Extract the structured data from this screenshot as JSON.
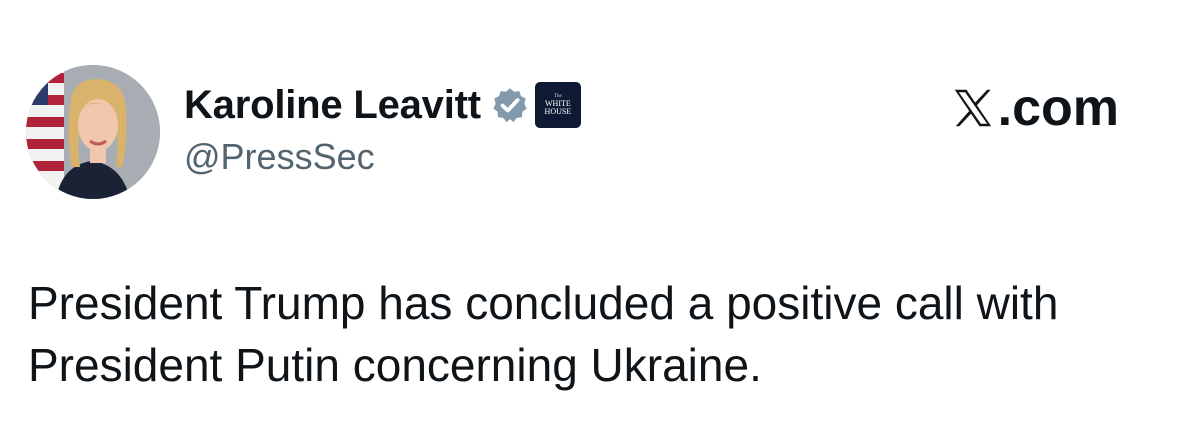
{
  "author": {
    "display_name": "Karoline Leavitt",
    "handle": "@PressSec",
    "verified": true,
    "verified_badge_color": "#829aab",
    "affiliate_badge": {
      "line1": "The",
      "line2": "WHITE",
      "line3": "HOUSE",
      "color": "#0e1a33"
    }
  },
  "source": {
    "label": ".com",
    "logo_icon": "x-logo-icon"
  },
  "tweet": {
    "text": "President Trump has concluded a positive call with President Putin concerning Ukraine."
  },
  "colors": {
    "text": "#0f1419",
    "secondary_text": "#536471",
    "background": "#ffffff"
  }
}
